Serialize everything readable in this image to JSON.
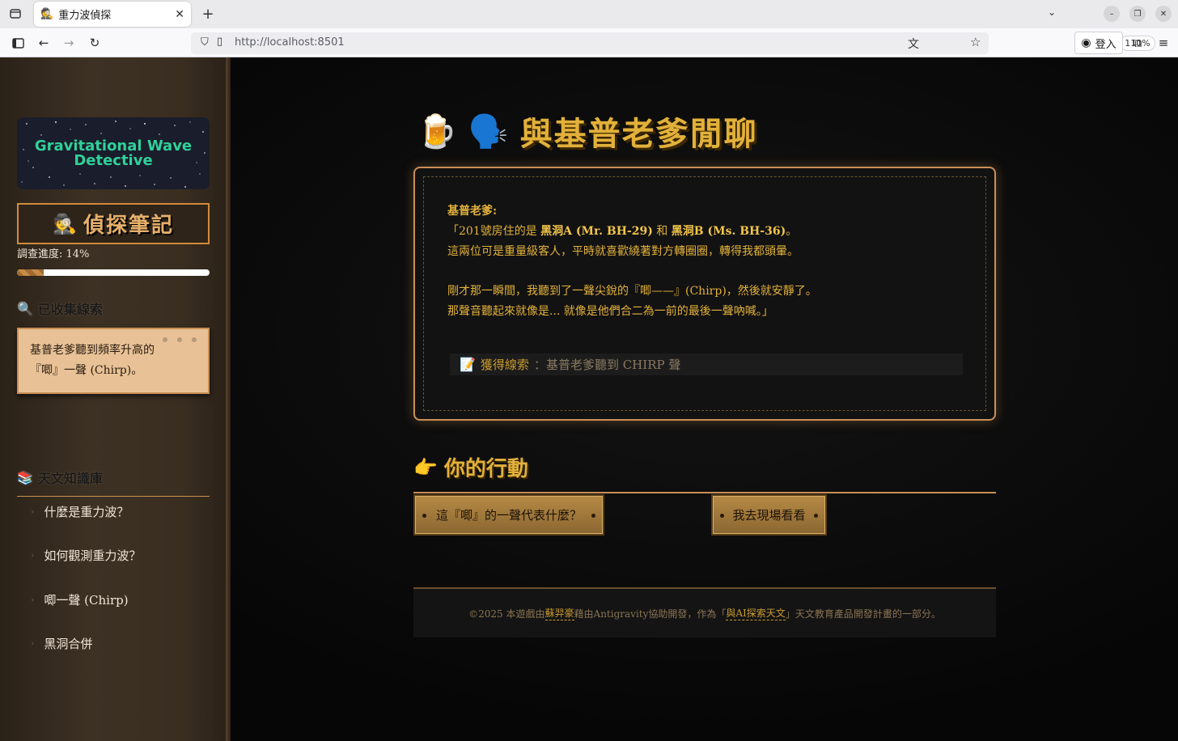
{
  "browser": {
    "tab_title": "重力波偵探",
    "tab_favicon": "🕵️",
    "url": "http://localhost:8501",
    "zoom": "110%",
    "signin_label": "登入"
  },
  "sidebar": {
    "logo_line1": "Gravitational Wave",
    "logo_line2": "Detective",
    "notebook_icon": "🕵️",
    "notebook_title": "偵探筆記",
    "progress_label": "調查進度: 14%",
    "progress_value": 0.14,
    "clues_icon": "🔍",
    "clues_heading": "已收集線索",
    "clues": [
      {
        "line1": "基普老爹聽到頻率升高的",
        "line2": "『唧』一聲 (Chirp)。"
      }
    ],
    "knowledge_icon": "📚",
    "knowledge_heading": "天文知識庫",
    "knowledge_items": [
      {
        "label": "什麼是重力波？"
      },
      {
        "label": "如何觀測重力波？"
      },
      {
        "label": "唧一聲 (Chirp)"
      },
      {
        "label": "黑洞合併"
      }
    ]
  },
  "scene": {
    "icon1": "🍺",
    "icon2": "🗣️",
    "title": "與基普老爹閒聊",
    "speaker": "基普老爹:",
    "line1_pre": "「201號房住的是 ",
    "line1_bh_a": "黑洞A (Mr. BH-29)",
    "line1_mid": " 和 ",
    "line1_bh_b": "黑洞B (Ms. BH-36)",
    "line1_post": "。",
    "line2": "這兩位可是重量級客人，平時就喜歡繞著對方轉圈圈，轉得我都頭暈。",
    "line3": "剛才那一瞬間，我聽到了一聲尖銳的『唧——』(Chirp)，然後就安靜了。",
    "line4": "那聲音聽起來就像是... 就像是他們合二為一前的最後一聲吶喊。」",
    "clue_icon": "📝",
    "clue_label": "獲得線索",
    "clue_value": "：基普老爹聽到 CHIRP 聲"
  },
  "actions": {
    "icon": "👉",
    "title": "你的行動",
    "buttons": [
      {
        "label": "這『唧』的一聲代表什麼？"
      },
      {
        "label": "我去現場看看"
      }
    ]
  },
  "footer": {
    "pre": "©2025 本遊戲由",
    "author": "蘇羿豪",
    "mid": "藉由Antigravity協助開發，作為「",
    "project": "與AI探索天文",
    "post": "」天文教育產品開發計畫的一部分。"
  }
}
